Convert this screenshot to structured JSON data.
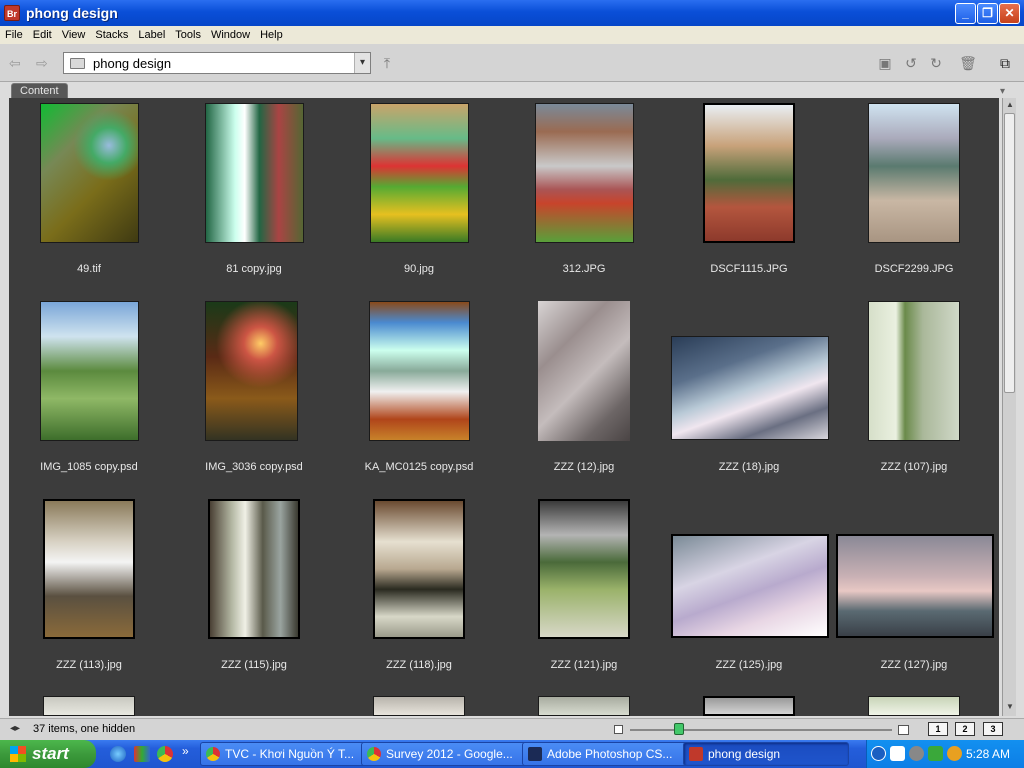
{
  "window": {
    "title": "phong design",
    "app_badge": "Br",
    "minimize": "_",
    "maximize": "❐",
    "close": "✕"
  },
  "menu": [
    "File",
    "Edit",
    "View",
    "Stacks",
    "Label",
    "Tools",
    "Window",
    "Help"
  ],
  "toolbar": {
    "path": "phong design",
    "back": "⇦",
    "forward": "⇨",
    "dropdown": "▾"
  },
  "panel": {
    "tab": "Content",
    "menu_glyph": "▾"
  },
  "thumbnails": [
    {
      "name": "49.tif"
    },
    {
      "name": "81 copy.jpg"
    },
    {
      "name": "90.jpg"
    },
    {
      "name": "312.JPG"
    },
    {
      "name": "DSCF1115.JPG"
    },
    {
      "name": "DSCF2299.JPG"
    },
    {
      "name": "IMG_1085 copy.psd"
    },
    {
      "name": "IMG_3036 copy.psd"
    },
    {
      "name": "KA_MC0125 copy.psd"
    },
    {
      "name": "ZZZ (12).jpg"
    },
    {
      "name": "ZZZ (18).jpg"
    },
    {
      "name": "ZZZ (107).jpg"
    },
    {
      "name": "ZZZ (113).jpg"
    },
    {
      "name": "ZZZ (115).jpg"
    },
    {
      "name": "ZZZ (118).jpg"
    },
    {
      "name": "ZZZ (121).jpg"
    },
    {
      "name": "ZZZ (125).jpg"
    },
    {
      "name": "ZZZ (127).jpg"
    }
  ],
  "status": {
    "text": "37 items, one hidden",
    "view1": "1",
    "view2": "2",
    "view3": "3"
  },
  "taskbar": {
    "start": "start",
    "tasks": [
      "TVC - Khơi Nguồn Ý T...",
      "Survey 2012 - Google...",
      "Adobe Photoshop CS...",
      "phong design"
    ],
    "clock": "5:28 AM",
    "chevron": "»"
  }
}
